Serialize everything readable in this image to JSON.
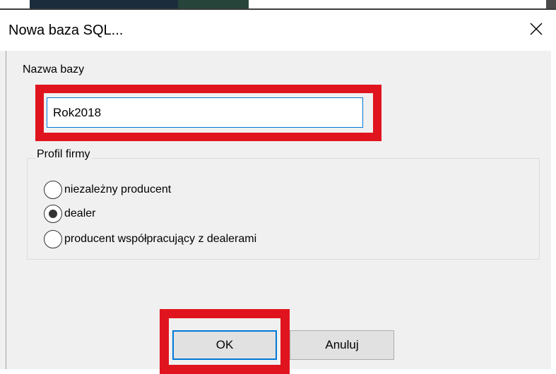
{
  "dialog": {
    "title": "Nowa baza SQL...",
    "close_icon": "close-icon"
  },
  "database_name": {
    "label": "Nazwa bazy",
    "value": "Rok2018"
  },
  "company_profile": {
    "legend": "Profil firmy",
    "options": [
      {
        "label": "niezależny producent",
        "selected": false
      },
      {
        "label": "dealer",
        "selected": true
      },
      {
        "label": "producent współpracujący z dealerami",
        "selected": false
      }
    ]
  },
  "buttons": {
    "ok": "OK",
    "cancel": "Anuluj"
  },
  "highlight_color": "#e0141e"
}
